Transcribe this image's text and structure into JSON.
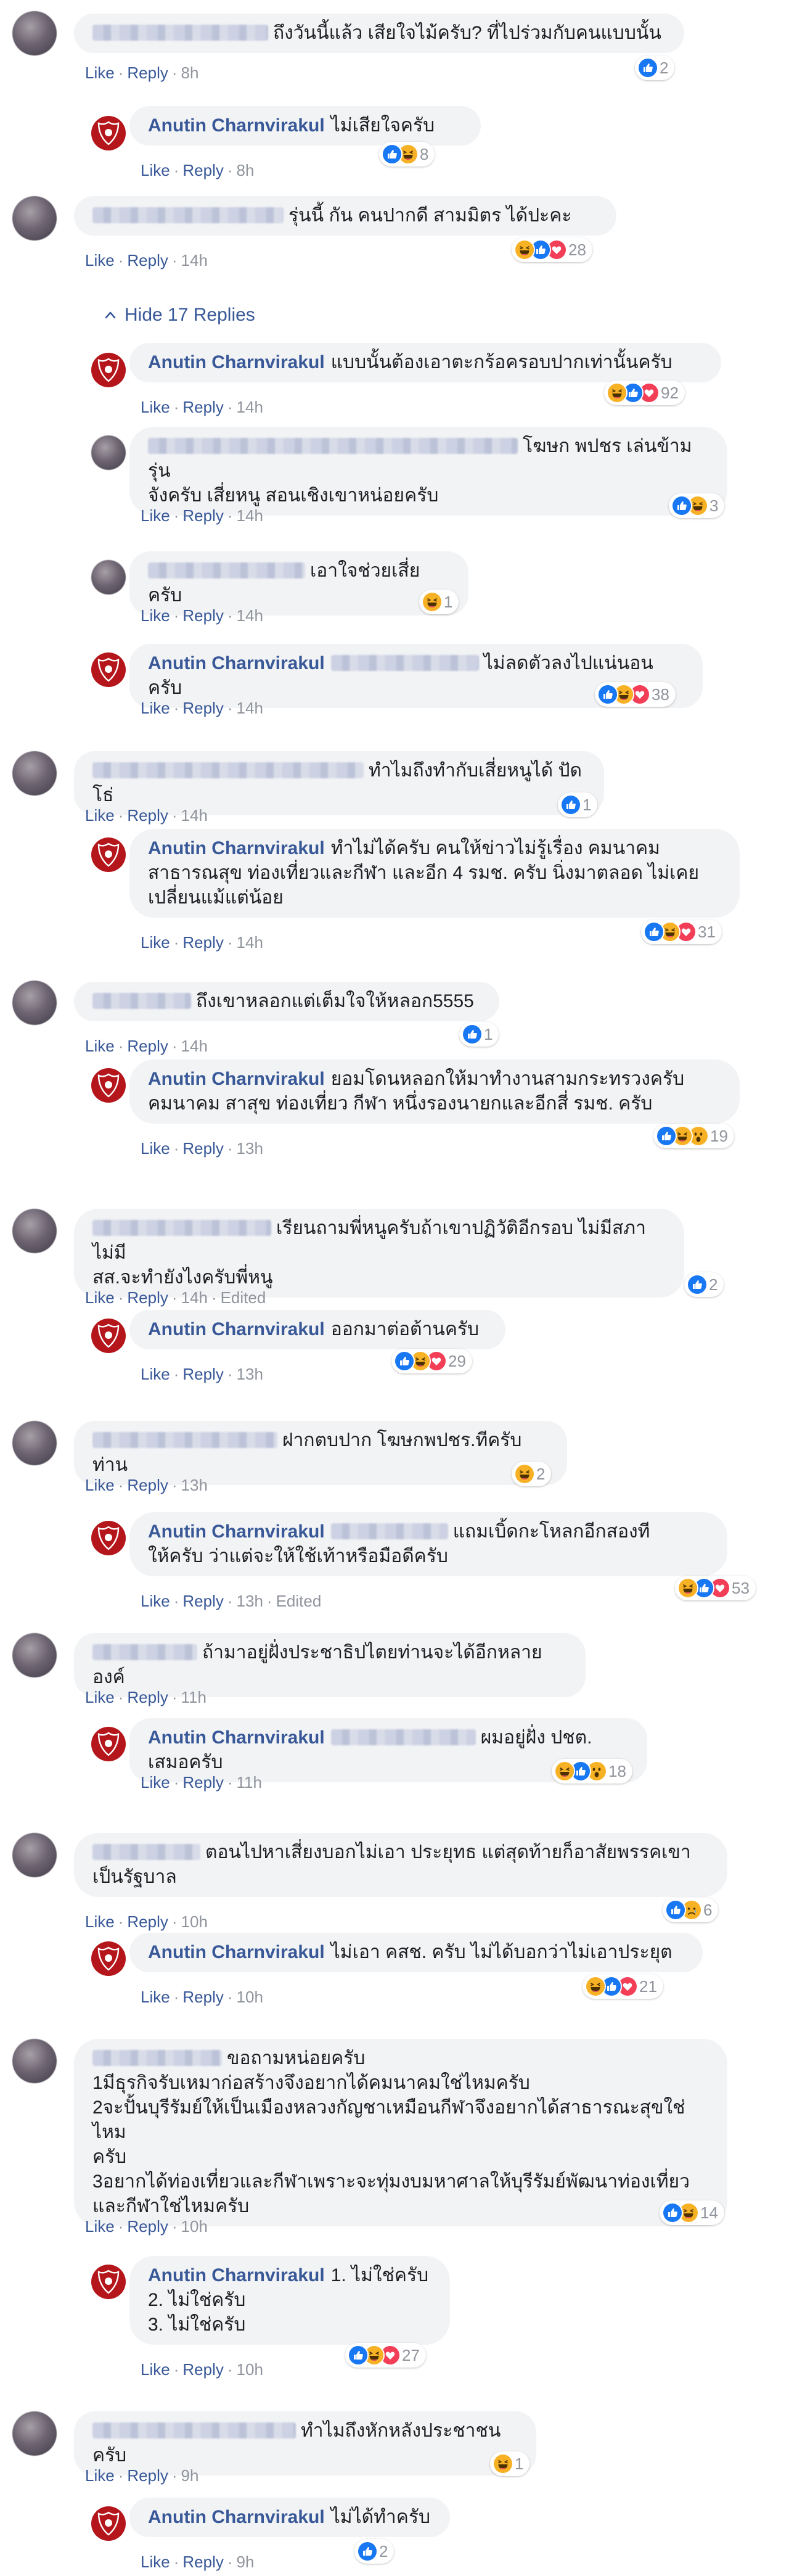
{
  "ui": {
    "like": "Like",
    "reply": "Reply",
    "hide_replies": "Hide 17 Replies"
  },
  "reply_author": "Anutin Charnvirakul",
  "colors": {
    "link": "#385898",
    "meta_gray": "#90949c",
    "bubble_bg": "#f2f3f5",
    "like_blue": "#1877f2",
    "love_red": "#f33e58",
    "haha_yellow": "#f7b125",
    "logo_red": "#b4161b"
  },
  "comments": [
    {
      "text": "ถึงวันนี้แล้ว เสียใจไม้ครับ? ที่ไปร่วมกับคนแบบนั้น",
      "time": "8h",
      "reactions": [
        "like-icon"
      ],
      "count": "2"
    },
    {
      "text": "ไม่เสียใจครับ",
      "time": "8h",
      "reactions": [
        "like-icon",
        "haha-icon"
      ],
      "count": "8"
    },
    {
      "text": "รุ่นนี้ กัน คนปากดี สามมิตร ได้ปะคะ",
      "time": "14h",
      "reactions": [
        "haha-icon",
        "like-icon",
        "love-icon"
      ],
      "count": "28"
    },
    {
      "text": "แบบนั้นต้องเอาตะกร้อครอบปากเท่านั้นครับ",
      "time": "14h",
      "reactions": [
        "haha-icon",
        "like-icon",
        "love-icon"
      ],
      "count": "92"
    },
    {
      "text": "โฆษก พปชร เล่นข้ามรุ่น\nจังครับ เสี่ยหนู สอนเชิงเขาหน่อยครับ",
      "time": "14h",
      "reactions": [
        "like-icon",
        "haha-icon"
      ],
      "count": "3"
    },
    {
      "text": "เอาใจช่วยเสี่ยครับ",
      "time": "14h",
      "reactions": [
        "haha-icon"
      ],
      "count": "1"
    },
    {
      "text": "ไม่ลดตัวลงไปแน่นอนครับ",
      "time": "14h",
      "reactions": [
        "like-icon",
        "haha-icon",
        "love-icon"
      ],
      "count": "38"
    },
    {
      "text": "ทำไมถึงทำกับเสี่ยหนูได้ ปัดโธ่",
      "time": "14h",
      "reactions": [
        "like-icon"
      ],
      "count": "1"
    },
    {
      "text": "ทำไม่ได้ครับ คนให้ข่าวไม่รู้เรื่อง คมนาคม\nสาธารณสุข ท่องเที่ยวและกีฬา และอีก 4 รมช. ครับ นิ่งมาตลอด ไม่เคย\nเปลี่ยนแม้แต่น้อย",
      "time": "14h",
      "reactions": [
        "like-icon",
        "haha-icon",
        "love-icon"
      ],
      "count": "31"
    },
    {
      "text": "ถึงเขาหลอกแต่เต็มใจให้หลอก5555",
      "time": "14h",
      "reactions": [
        "like-icon"
      ],
      "count": "1"
    },
    {
      "text": "ยอมโดนหลอกให้มาทำงานสามกระทรวงครับ\nคมนาคม สาสุข ท่องเที่ยว กีฬา หนึ่งรองนายกและอีกสี่ รมช. ครับ",
      "time": "13h",
      "reactions": [
        "like-icon",
        "haha-icon",
        "wow-icon"
      ],
      "count": "19"
    },
    {
      "text": "เรียนถามพี่หนูครับถ้าเขาปฏิวัติอีกรอบ ไม่มีสภาไม่มี\nสส.จะทำยังไงครับพี่หนู",
      "time": "14h",
      "edited": "Edited",
      "reactions": [
        "like-icon"
      ],
      "count": "2"
    },
    {
      "text": "ออกมาต่อต้านครับ",
      "time": "13h",
      "reactions": [
        "like-icon",
        "haha-icon",
        "love-icon"
      ],
      "count": "29"
    },
    {
      "text": "ฝากตบปาก โฆษกพปชร.ทีครับท่าน",
      "time": "13h",
      "reactions": [
        "haha-icon"
      ],
      "count": "2"
    },
    {
      "text": "แถมเบิ้ดกะโหลกอีกสองที\nให้ครับ ว่าแต่จะให้ใช้เท้าหรือมือดีครับ",
      "time": "13h",
      "edited": "Edited",
      "reactions": [
        "haha-icon",
        "like-icon",
        "love-icon"
      ],
      "count": "53"
    },
    {
      "text": "ถ้ามาอยู่ฝั่งประชาธิปไตยท่านจะได้อีกหลายองค์",
      "time": "11h",
      "reactions": [],
      "count": ""
    },
    {
      "text": "ผมอยู่ฝั่ง ปชต. เสมอครับ",
      "time": "11h",
      "reactions": [
        "haha-icon",
        "like-icon",
        "wow-icon"
      ],
      "count": "18"
    },
    {
      "text": "ตอนไปหาเสี่ยงบอกไม่เอา ประยุทธ แต่สุดท้ายก็อาสัยพรรคเขา\nเป็นรัฐบาล",
      "time": "10h",
      "reactions": [
        "like-icon",
        "sad-icon"
      ],
      "count": "6"
    },
    {
      "text": "ไม่เอา คสช. ครับ ไม่ได้บอกว่าไม่เอาประยุต",
      "time": "10h",
      "reactions": [
        "haha-icon",
        "like-icon",
        "love-icon"
      ],
      "count": "21"
    },
    {
      "text": "ขอถามหน่อยครับ\n1มีธุรกิจรับเหมาก่อสร้างจึงอยากได้คมนาคมใช่ไหมครับ\n2จะปั้นบุรีรัมย์ให้เป็นเมืองหลวงกัญชาเหมือนกีฬาจึงอยากได้สาธารณะสุขใช่ไหม\nครับ\n3อยากได้ท่องเที่ยวและกีฬาเพราะจะทุ่มงบมหาศาลให้บุรีรัมย์พัฒนาท่องเที่ยว\nและกีฬาใช่ไหมครับ",
      "time": "10h",
      "reactions": [
        "like-icon",
        "haha-icon"
      ],
      "count": "14"
    },
    {
      "text": "1. ไม่ใช่ครับ\n2. ไม่ใช่ครับ\n3. ไม่ใช่ครับ",
      "time": "10h",
      "reactions": [
        "like-icon",
        "haha-icon",
        "love-icon"
      ],
      "count": "27"
    },
    {
      "text": "ทำไมถึงหักหลังประชาชนครับ",
      "time": "9h",
      "reactions": [
        "haha-icon"
      ],
      "count": "1"
    },
    {
      "text": "ไม่ได้ทำครับ",
      "time": "9h",
      "reactions": [
        "like-icon"
      ],
      "count": "2"
    }
  ]
}
